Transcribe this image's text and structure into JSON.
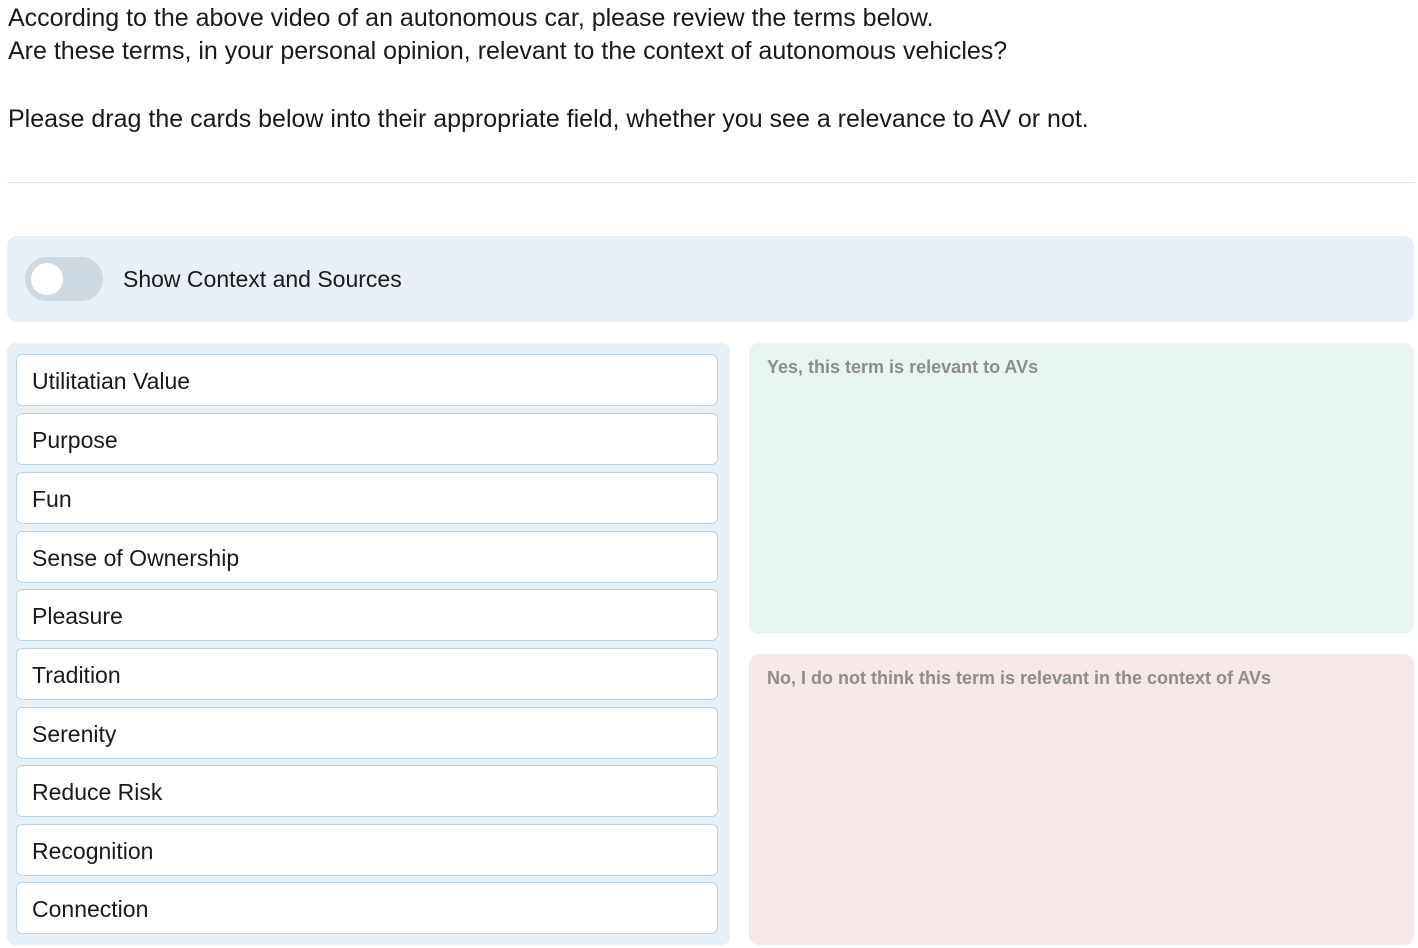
{
  "instructions": {
    "line1": "According to the above video of an autonomous car, please review the terms below.",
    "line2": "Are these terms, in your personal opinion, relevant to the context of autonomous vehicles?",
    "line3": "Please drag the cards below into their appropriate field, whether you see a relevance to AV or not."
  },
  "toggle": {
    "label": "Show Context and Sources",
    "checked": false
  },
  "cards": [
    {
      "label": "Utilitatian Value"
    },
    {
      "label": "Purpose"
    },
    {
      "label": "Fun"
    },
    {
      "label": "Sense of Ownership"
    },
    {
      "label": "Pleasure"
    },
    {
      "label": "Tradition"
    },
    {
      "label": "Serenity"
    },
    {
      "label": "Reduce Risk"
    },
    {
      "label": "Recognition"
    },
    {
      "label": "Connection"
    }
  ],
  "drop_zones": {
    "yes": {
      "title": "Yes, this term is relevant to AVs",
      "color": "#e8f5ef"
    },
    "no": {
      "title": "No, I do not think this term is relevant in the context of AVs",
      "color": "#f7e8e8"
    }
  }
}
